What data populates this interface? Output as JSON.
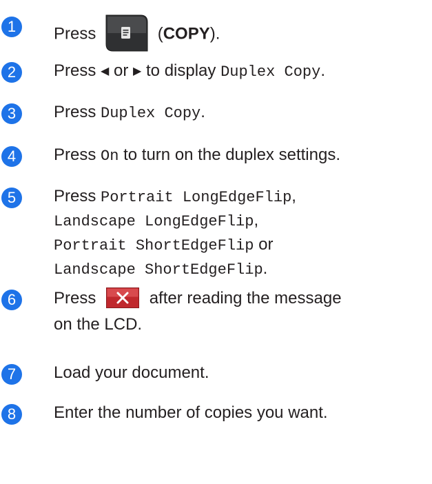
{
  "accent_color": "#1e73e8",
  "icons": {
    "copy_button": "copy-document-icon",
    "stop_button": "cancel-x-icon",
    "left": "left-arrow-icon",
    "right": "right-arrow-icon"
  },
  "steps": [
    {
      "number": "1",
      "press": "Press",
      "copy_label": "COPY",
      "open_paren": "(",
      "close_paren": ")."
    },
    {
      "number": "2",
      "press": "Press",
      "or": "or",
      "to_display": "to display",
      "option": "Duplex Copy",
      "end": "."
    },
    {
      "number": "3",
      "press": "Press",
      "option": "Duplex Copy",
      "end": "."
    },
    {
      "number": "4",
      "press": "Press",
      "option": "On",
      "rest": "to turn on the duplex settings."
    },
    {
      "number": "5",
      "press": "Press",
      "opt1": "Portrait LongEdgeFlip",
      "sep1": ",",
      "opt2": "Landscape LongEdgeFlip",
      "sep2": ",",
      "opt3": "Portrait ShortEdgeFlip",
      "or": "or",
      "opt4": "Landscape ShortEdgeFlip",
      "end": "."
    },
    {
      "number": "6",
      "press": "Press",
      "rest1": "after reading the message",
      "rest2": "on the LCD."
    },
    {
      "number": "7",
      "text": "Load your document."
    },
    {
      "number": "8",
      "text": "Enter the number of copies you want."
    }
  ]
}
